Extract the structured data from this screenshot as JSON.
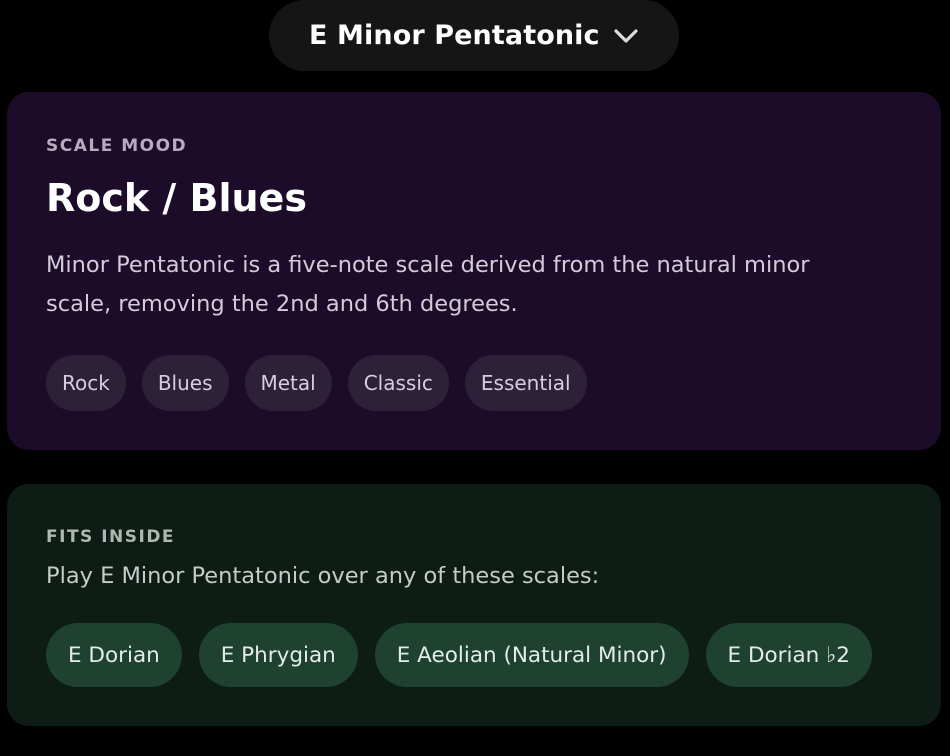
{
  "selector": {
    "title": "E Minor Pentatonic",
    "icon": "chevron-down-icon"
  },
  "mood": {
    "label": "SCALE MOOD",
    "title": "Rock / Blues",
    "description": "Minor Pentatonic is a five-note scale derived from the natural minor scale, removing the 2nd and 6th degrees.",
    "tags": [
      "Rock",
      "Blues",
      "Metal",
      "Classic",
      "Essential"
    ]
  },
  "fits": {
    "label": "FITS INSIDE",
    "description": "Play E Minor Pentatonic over any of these scales:",
    "scales": [
      "E Dorian",
      "E Phrygian",
      "E Aeolian (Natural Minor)",
      "E Dorian ♭2"
    ]
  },
  "colors": {
    "background": "#000000",
    "mood_card": "#1c0c2a",
    "mood_tag": "#2d2139",
    "fits_card": "#0d1d16",
    "fits_pill": "#1f4230"
  }
}
